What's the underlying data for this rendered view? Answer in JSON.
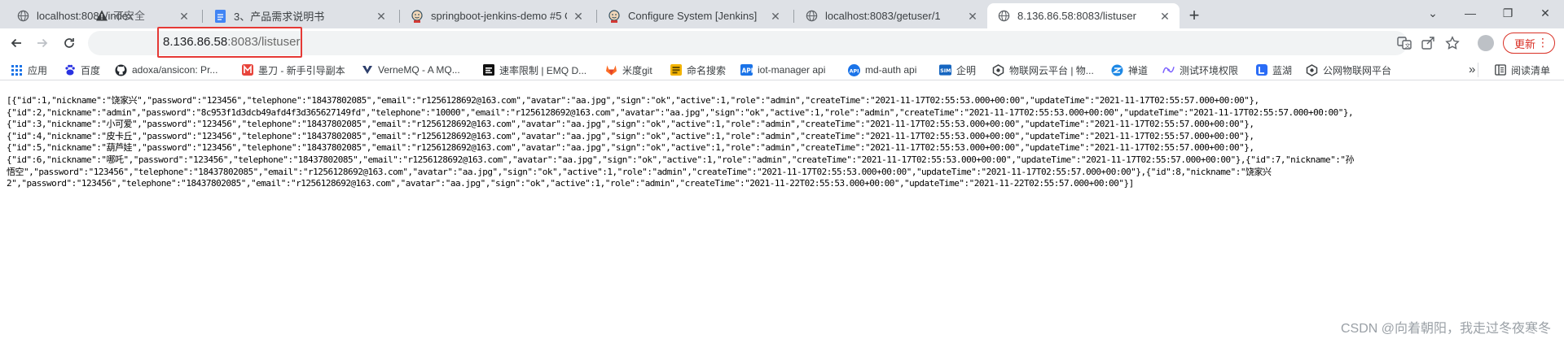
{
  "tabs": [
    {
      "title": "localhost:8081/index",
      "favicon": "globe-icon"
    },
    {
      "title": "3、产品需求说明书",
      "favicon": "doc-icon"
    },
    {
      "title": "springboot-jenkins-demo #5 C",
      "favicon": "jenkins-icon"
    },
    {
      "title": "Configure System [Jenkins]",
      "favicon": "jenkins-icon"
    },
    {
      "title": "localhost:8083/getuser/1",
      "favicon": "globe-icon"
    },
    {
      "title": "8.136.86.58:8083/listuser",
      "favicon": "globe-icon"
    }
  ],
  "address_bar": {
    "security_label": "不安全",
    "url_host": "8.136.86.58",
    "url_path": ":8083/listuser"
  },
  "update_button": {
    "label": "更新"
  },
  "bookmarks": [
    {
      "label": "应用",
      "icon": "apps-grid-icon"
    },
    {
      "label": "百度",
      "icon": "baidu-icon"
    },
    {
      "label": "adoxa/ansicon: Pr...",
      "icon": "github-icon"
    },
    {
      "label": "墨刀 - 新手引导副本",
      "icon": "modao-icon"
    },
    {
      "label": "VerneMQ - A MQ...",
      "icon": "vernemq-icon"
    },
    {
      "label": "速率限制 | EMQ D...",
      "icon": "emq-icon"
    },
    {
      "label": "米度git",
      "icon": "gitlab-icon"
    },
    {
      "label": "命名搜索",
      "icon": "search-name-icon"
    },
    {
      "label": "iot-manager api",
      "icon": "api-icon"
    },
    {
      "label": "md-auth api",
      "icon": "api-icon"
    },
    {
      "label": "企明",
      "icon": "sim-icon"
    },
    {
      "label": "物联网云平台 | 物...",
      "icon": "iot-icon"
    },
    {
      "label": "禅道",
      "icon": "zentao-icon"
    },
    {
      "label": "测试环境权限",
      "icon": "test-env-icon"
    },
    {
      "label": "蓝湖",
      "icon": "lanhu-icon"
    },
    {
      "label": "公网物联网平台",
      "icon": "iot-icon"
    }
  ],
  "bookmarks_overflow": "»",
  "reading_list": {
    "label": "阅读清单",
    "icon": "reading-list-icon"
  },
  "page_text": "[{\"id\":1,\"nickname\":\"饶家兴\",\"password\":\"123456\",\"telephone\":\"18437802085\",\"email\":\"r1256128692@163.com\",\"avatar\":\"aa.jpg\",\"sign\":\"ok\",\"active\":1,\"role\":\"admin\",\"createTime\":\"2021-11-17T02:55:53.000+00:00\",\"updateTime\":\"2021-11-17T02:55:57.000+00:00\"},\n{\"id\":2,\"nickname\":\"admin\",\"password\":\"8c953f1d3dcb49afd4f3d365627149fd\",\"telephone\":\"10000\",\"email\":\"r1256128692@163.com\",\"avatar\":\"aa.jpg\",\"sign\":\"ok\",\"active\":1,\"role\":\"admin\",\"createTime\":\"2021-11-17T02:55:53.000+00:00\",\"updateTime\":\"2021-11-17T02:55:57.000+00:00\"},\n{\"id\":3,\"nickname\":\"小可爱\",\"password\":\"123456\",\"telephone\":\"18437802085\",\"email\":\"r1256128692@163.com\",\"avatar\":\"aa.jpg\",\"sign\":\"ok\",\"active\":1,\"role\":\"admin\",\"createTime\":\"2021-11-17T02:55:53.000+00:00\",\"updateTime\":\"2021-11-17T02:55:57.000+00:00\"},\n{\"id\":4,\"nickname\":\"皮卡丘\",\"password\":\"123456\",\"telephone\":\"18437802085\",\"email\":\"r1256128692@163.com\",\"avatar\":\"aa.jpg\",\"sign\":\"ok\",\"active\":1,\"role\":\"admin\",\"createTime\":\"2021-11-17T02:55:53.000+00:00\",\"updateTime\":\"2021-11-17T02:55:57.000+00:00\"},\n{\"id\":5,\"nickname\":\"葫芦娃\",\"password\":\"123456\",\"telephone\":\"18437802085\",\"email\":\"r1256128692@163.com\",\"avatar\":\"aa.jpg\",\"sign\":\"ok\",\"active\":1,\"role\":\"admin\",\"createTime\":\"2021-11-17T02:55:53.000+00:00\",\"updateTime\":\"2021-11-17T02:55:57.000+00:00\"},\n{\"id\":6,\"nickname\":\"哪吒\",\"password\":\"123456\",\"telephone\":\"18437802085\",\"email\":\"r1256128692@163.com\",\"avatar\":\"aa.jpg\",\"sign\":\"ok\",\"active\":1,\"role\":\"admin\",\"createTime\":\"2021-11-17T02:55:53.000+00:00\",\"updateTime\":\"2021-11-17T02:55:57.000+00:00\"},{\"id\":7,\"nickname\":\"孙\n悟空\",\"password\":\"123456\",\"telephone\":\"18437802085\",\"email\":\"r1256128692@163.com\",\"avatar\":\"aa.jpg\",\"sign\":\"ok\",\"active\":1,\"role\":\"admin\",\"createTime\":\"2021-11-17T02:55:53.000+00:00\",\"updateTime\":\"2021-11-17T02:55:57.000+00:00\"},{\"id\":8,\"nickname\":\"饶家兴\n2\",\"password\":\"123456\",\"telephone\":\"18437802085\",\"email\":\"r1256128692@163.com\",\"avatar\":\"aa.jpg\",\"sign\":\"ok\",\"active\":1,\"role\":\"admin\",\"createTime\":\"2021-11-22T02:55:53.000+00:00\",\"updateTime\":\"2021-11-22T02:55:57.000+00:00\"}]",
  "watermark": "CSDN @向着朝阳，我走过冬夜寒冬",
  "colors": {
    "tabstrip_bg": "#dee1e6",
    "highlight_box": "#e53935",
    "update_button": "#d93025"
  }
}
